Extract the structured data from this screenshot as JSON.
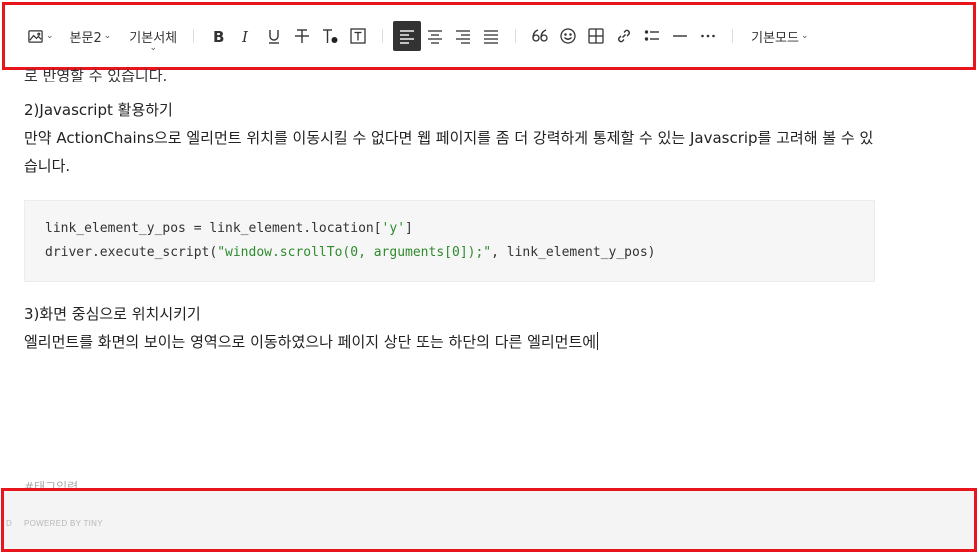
{
  "toolbar": {
    "image_dd_caret": "⌄",
    "paragraph_style": "본문2",
    "font_family": "기본서체",
    "mode": "기본모드",
    "items": [
      {
        "name": "bold-icon"
      },
      {
        "name": "italic-icon"
      },
      {
        "name": "underline-icon"
      },
      {
        "name": "strikethrough-icon"
      },
      {
        "name": "text-color-icon"
      },
      {
        "name": "text-background-icon"
      },
      {
        "name": "align-left-icon",
        "active": true
      },
      {
        "name": "align-center-icon"
      },
      {
        "name": "align-right-icon"
      },
      {
        "name": "align-justify-icon"
      },
      {
        "name": "quote-icon"
      },
      {
        "name": "emoji-icon"
      },
      {
        "name": "table-icon"
      },
      {
        "name": "link-icon"
      },
      {
        "name": "list-icon"
      },
      {
        "name": "horizontal-rule-icon"
      },
      {
        "name": "more-icon"
      }
    ],
    "accent_active": "#333333"
  },
  "content": {
    "cut_line": "로 반영할 수 있습니다.",
    "heading2": "2)Javascript 활용하기",
    "para2": "만약 ActionChains으로 엘리먼트 위치를 이동시킬 수 없다면 웹 페이지를 좀 더 강력하게 통제할 수 있는 Javascrip를 고려해 볼 수 있습니다.",
    "code": {
      "line1_a": "link_element_y_pos = link_element.location[",
      "line1_str": "'y'",
      "line1_b": "]",
      "line2_a": "driver.execute_script(",
      "line2_str": "\"window.scrollTo(0, arguments[0]);\"",
      "line2_b": ", link_element_y_pos)"
    },
    "heading3": "3)화면 중심으로 위치시키기",
    "para3": "엘리먼트를 화면의 보이는 영역으로 이동하였으나 페이지 상단 또는 하단의 다른 엘리먼트에"
  },
  "tag_hint": "#태그입력",
  "statusbar": {
    "edge_char": "D",
    "powered_by": "POWERED BY TINY"
  },
  "colors": {
    "highlight_border": "#e8161c",
    "code_string": "#2e8b2e"
  }
}
